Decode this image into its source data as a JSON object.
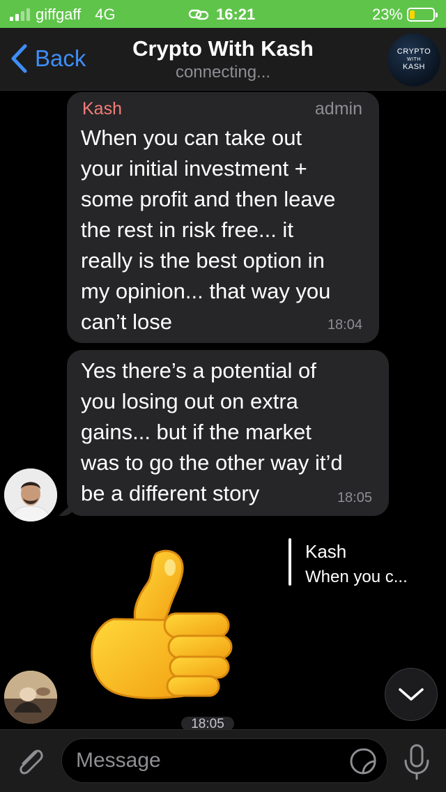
{
  "status_bar": {
    "carrier": "giffgaff",
    "network": "4G",
    "time": "16:21",
    "battery_text": "23%",
    "battery_level": 0.23,
    "background_color": "#5fc44a"
  },
  "nav": {
    "back_label": "Back",
    "title": "Crypto With Kash",
    "subtitle": "connecting...",
    "avatar_line1": "CRYPTO",
    "avatar_line2": "WITH",
    "avatar_line3": "KASH",
    "accent_color": "#3e8ef7"
  },
  "messages": [
    {
      "sender": "Kash",
      "role": "admin",
      "text": "When you can take out\nyour initial investment +\nsome profit and then leave\nthe rest in risk free... it\nreally is the best option in\nmy opinion... that way you\ncan’t lose",
      "time": "18:04"
    },
    {
      "text": "Yes there’s a potential of\nyou losing out on extra\ngains... but if the market\nwas to go the other way it’d\nbe a different story",
      "time": "18:05"
    },
    {
      "type": "sticker",
      "sticker_icon": "thumbs-up",
      "reply_to_name": "Kash",
      "reply_to_text": "When you c...",
      "time": "18:05"
    }
  ],
  "input": {
    "placeholder": "Message"
  }
}
